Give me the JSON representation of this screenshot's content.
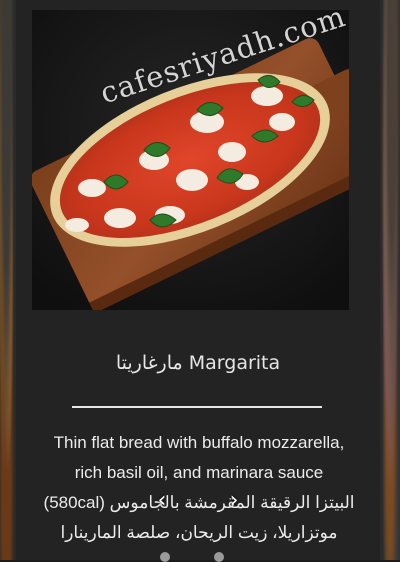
{
  "item": {
    "title": "مارغاريتا Margarita",
    "description_en_1": "Thin flat bread with buffalo mozzarella,",
    "description_en_2": "rich basil oil, and marinara sauce",
    "description_ar_1": "البيتزا الرقيقة المقرمشة بالجاموس (580cal)",
    "description_ar_2": "موتزاريلا، زيت الريحان، صلصة المارينارا"
  },
  "image": {
    "watermark": "cafesriyadh.com",
    "subject": "margherita-pizza-on-wooden-board"
  },
  "carousel": {
    "prev_icon": "chevron-left-icon",
    "prev_glyph": "‹",
    "next_icon": "chevron-right-icon",
    "next_glyph": "›"
  },
  "colors": {
    "background": "#1c1c1c",
    "card": "#232323",
    "text": "#e6e6e6",
    "divider": "#e8e8e8"
  }
}
